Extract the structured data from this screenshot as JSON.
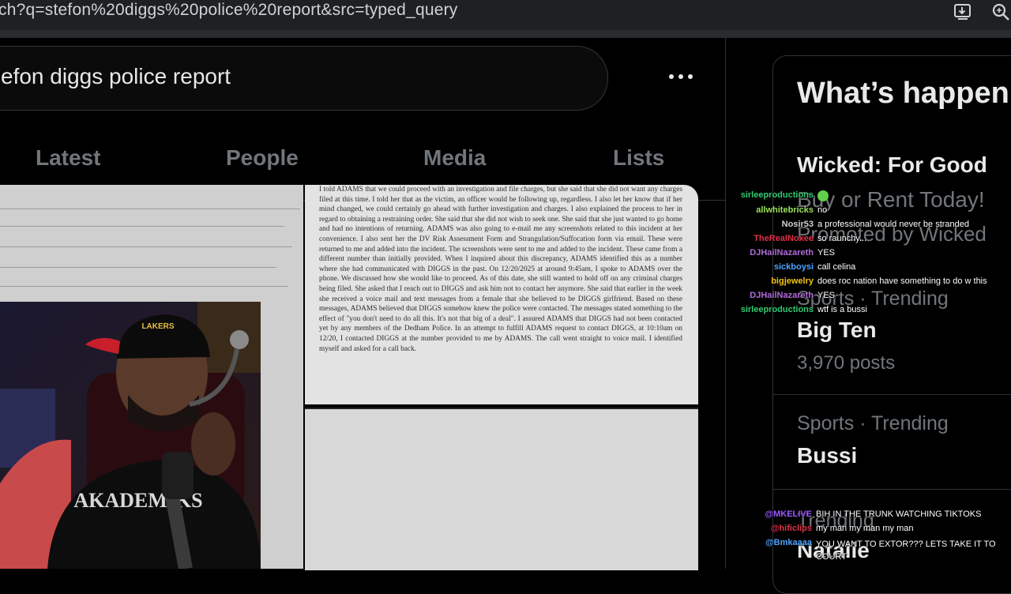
{
  "browser": {
    "url": "ch?q=stefon%20diggs%20police%20report&src=typed_query"
  },
  "search": {
    "query": "efon diggs police report"
  },
  "tabs": [
    "Latest",
    "People",
    "Media",
    "Lists"
  ],
  "document": {
    "text": "I told ADAMS that we could proceed with an investigation and file charges, but she said that she did not want any charges filed at this time. I told her that as the victim, an officer would be following up, regardless. I also let her know that if her mind changed, we could certainly go ahead with further investigation and charges. I also explained the process to her in regard to obtaining a restraining order. She said that she did not wish to seek one. She said that she just wanted to go home and had no intentions of returning. ADAMS was also going to e-mail me any screenshots related to this incident at her convenience. I also sent her the DV Risk Assessment Form and Strangulation/Suffocation form via email. These were returned to me and added into the incident. The screenshots were sent to me and added to the incident. These came from a different number than initially provided. When I inquired about this discrepancy, ADAMS identified this as a number where she had communicated with DIGGS in the past. On 12/20/2025 at around 9:45am, I spoke to ADAMS over the phone. We discussed how she would like to proceed. As of this date, she still wanted to hold off on any criminal charges being filed. She asked that I reach out to DIGGS and ask him not to contact her anymore. She said that earlier in the week she received a voice mail and text messages from a female that she believed to be DIGGS girlfriend. Based on these messages, ADAMS believed that DIGGS somehow knew the police were contacted. The messages stated something to the effect of \"you don't need to do all this. It's not that big of a deal\". I assured ADAMS that DIGGS had not been contacted yet by any members of the Dedham Police. In an attempt to fulfill ADAMS request to contact DIGGS, at 10:10am on 12/20, I contacted DIGGS at the number provided to me by ADAMS. The call went straight to voice mail. I identified myself and asked for a call back."
  },
  "sidebar": {
    "title": "What’s happen",
    "promo": {
      "title": "Wicked: For Good",
      "subtitle": "Buy or Rent Today!",
      "promoted": "Promoted by Wicked"
    },
    "trends": [
      {
        "context": "Sports · Trending",
        "name": "Big Ten",
        "count": "3,970 posts"
      },
      {
        "context": "Sports · Trending",
        "name": "Bussi",
        "count": ""
      },
      {
        "context": "Trending",
        "name": "Natalie",
        "count": ""
      }
    ]
  },
  "chat": {
    "top": [
      {
        "user": "sirleeproductions",
        "msg": "",
        "color": "#2ecc71"
      },
      {
        "user": "allwhitebricks",
        "msg": "no",
        "color": "#9be15d"
      },
      {
        "user": "Nosir53",
        "msg": "a professional would never be stranded",
        "color": "#d0d0d0"
      },
      {
        "user": "TheRealNoxee",
        "msg": "so raunchy...",
        "color": "#e0304a"
      },
      {
        "user": "DJHailNazareth",
        "msg": "YES",
        "color": "#b06ad9"
      },
      {
        "user": "sickboysi",
        "msg": "call celina",
        "color": "#4da3ff"
      },
      {
        "user": "bigjewelry",
        "msg": "does roc nation have something to do w this",
        "color": "#f1c40f"
      },
      {
        "user": "DJHailNazareth",
        "msg": "YES",
        "color": "#b06ad9"
      },
      {
        "user": "sirleeproductions",
        "msg": "wtf is a bussi",
        "color": "#2ecc71"
      }
    ],
    "bottom": [
      {
        "user": "@MKELIVE",
        "msg": "BIH IN THE TRUNK WATCHING TIKTOKS",
        "color": "#9b59ff"
      },
      {
        "user": "@hificlips",
        "msg": "my man my man my man",
        "color": "#e0304a"
      },
      {
        "user": "@Bmkaaaa",
        "msg": "YOU WANT TO EXTOR??? LETS TAKE IT TO COURT",
        "color": "#4da3ff"
      }
    ]
  },
  "webcam": {
    "hat_text": "LAKERS",
    "shirt_text": "AKADEMIKS"
  }
}
